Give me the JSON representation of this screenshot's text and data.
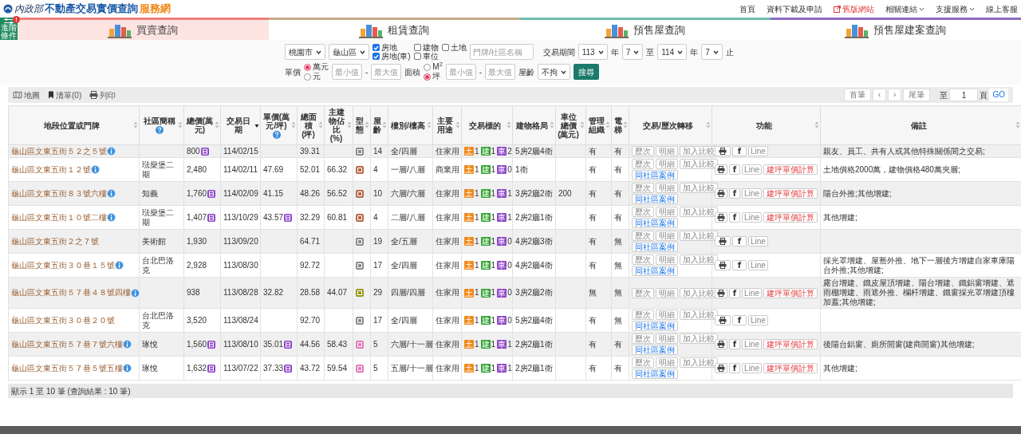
{
  "header": {
    "ministry": "內政部",
    "title": "不動產交易實價查詢",
    "suffix": "服務網",
    "nav": [
      {
        "label": "首頁",
        "kind": "link"
      },
      {
        "label": "資料下載及申請",
        "kind": "link"
      },
      {
        "label": "舊版網站",
        "kind": "external"
      },
      {
        "label": "相關連結",
        "kind": "dropdown"
      },
      {
        "label": "支援服務",
        "kind": "dropdown"
      },
      {
        "label": "線上客服",
        "kind": "link"
      }
    ]
  },
  "advanced_button": {
    "label": "進階條件",
    "badge": "!"
  },
  "tabs": [
    {
      "label": "買賣查詢",
      "selected": true,
      "color": "#ee7f7a"
    },
    {
      "label": "租賃查詢",
      "selected": false,
      "color": "#c9aa88"
    },
    {
      "label": "預售屋查詢",
      "selected": false,
      "color": "#6cc0ae"
    },
    {
      "label": "預售屋建案查詢",
      "selected": false,
      "color": "#8e6cc4"
    }
  ],
  "filters": {
    "city": "桃園市",
    "district": "龜山區",
    "types": [
      {
        "label": "房地",
        "checked": true
      },
      {
        "label": "建物",
        "checked": false
      },
      {
        "label": "土地",
        "checked": false
      },
      {
        "label": "房地(車)",
        "checked": true
      },
      {
        "label": "車位",
        "checked": false
      }
    ],
    "keyword_placeholder": "門牌/社區名稱",
    "period_label": "交易期間",
    "start_year": "113",
    "start_year_unit": "年",
    "start_month": "7",
    "to": "至",
    "end_year": "114",
    "end_year_unit": "年",
    "end_month": "7",
    "end": "止",
    "price_label": "單價",
    "price_units": [
      {
        "label": "萬元",
        "selected": true
      },
      {
        "label": "元",
        "selected": false
      }
    ],
    "price_min_placeholder": "最小值",
    "price_dash": "-",
    "price_max_placeholder": "最大值",
    "area_label": "面積",
    "area_units": [
      {
        "label": "M$^{2}$",
        "selected": false
      },
      {
        "label": "坪",
        "selected": true
      }
    ],
    "area_min_placeholder": "最小值",
    "area_dash": "-",
    "area_max_placeholder": "最大值",
    "age_label": "屋齡",
    "age_value": "不拘",
    "search_button": "搜尋"
  },
  "toolbar": {
    "map": "地圖",
    "list": "清單(0)",
    "print": "列印",
    "first": "首筆",
    "prev": "‹",
    "next": "›",
    "last": "尾筆",
    "goto_label": "至",
    "page": "1",
    "page_unit": "頁",
    "go": "GO"
  },
  "table": {
    "columns": [
      {
        "label": "地段位置或門牌",
        "help": false,
        "sorted": false
      },
      {
        "label": "社區簡稱",
        "help": true,
        "sorted": false
      },
      {
        "label": "總價(萬元)",
        "help": false,
        "sorted": false
      },
      {
        "label": "交易日期",
        "help": false,
        "sorted": true
      },
      {
        "label": "單價(萬元/坪)",
        "help": true,
        "sorted": false
      },
      {
        "label": "總面積(坪)",
        "help": false,
        "sorted": false
      },
      {
        "label": "主建物佔比(%)",
        "help": false,
        "sorted": false
      },
      {
        "label": "型態",
        "help": false,
        "sorted": false
      },
      {
        "label": "屋齡",
        "help": false,
        "sorted": false
      },
      {
        "label": "樓別/樓高",
        "help": false,
        "sorted": false
      },
      {
        "label": "主要用途",
        "help": false,
        "sorted": false
      },
      {
        "label": "交易標的",
        "help": false,
        "sorted": false
      },
      {
        "label": "建物格局",
        "help": false,
        "sorted": false
      },
      {
        "label": "車位總價(萬元)",
        "help": false,
        "sorted": false
      },
      {
        "label": "管理組織",
        "help": false,
        "sorted": false
      },
      {
        "label": "電梯",
        "help": false,
        "sorted": false
      },
      {
        "label": "交易/歷次轉移",
        "help": false,
        "sorted": false
      },
      {
        "label": "功能",
        "help": false,
        "sorted": false
      },
      {
        "label": "備註",
        "help": false,
        "sorted": false
      }
    ],
    "rows": [
      {
        "address": "龜山區文東五街５２之５號",
        "info": true,
        "price": "800",
        "price_badge": true,
        "date": "114/02/15",
        "unit_badge": false,
        "area": "39.31",
        "type": {
          "color": "#8c8c8c"
        },
        "age": "14",
        "floor": "全/四層",
        "use": "住家用",
        "target": [
          {
            "label": "土",
            "count": "1",
            "color": "#f08a1c"
          },
          {
            "label": "建",
            "count": "1",
            "color": "#2ea02e"
          },
          {
            "label": "車",
            "count": "2",
            "color": "#8e44c9"
          }
        ],
        "layout": "5房2廳4衛",
        "management": "有",
        "elevator": "有",
        "actions": [
          "歷次",
          "明細",
          "加入比較"
        ],
        "share": [
          "f",
          "Line"
        ],
        "remark": "親友、員工、共有人或其他特殊關係間之交易;"
      },
      {
        "address": "龜山區文東五街１２號",
        "info": true,
        "community": "琺燊堡二期",
        "price": "2,480",
        "price_badge": false,
        "date": "114/02/11",
        "unit_price": "47.69",
        "unit_badge": false,
        "area": "52.01",
        "ratio": "66.32",
        "type": {
          "color": "#b5694a"
        },
        "age": "4",
        "floor": "一層/八層",
        "use": "商業用",
        "target": [
          {
            "label": "土",
            "count": "1",
            "color": "#f08a1c"
          },
          {
            "label": "建",
            "count": "1",
            "color": "#2ea02e"
          },
          {
            "label": "車",
            "count": "0",
            "color": "#8e44c9"
          }
        ],
        "layout": "1衛",
        "management": "有",
        "elevator": "有",
        "actions": [
          "歷次",
          "明細",
          "加入比較",
          "同社區案例"
        ],
        "share": [
          "f",
          "Line",
          "建坪單價計算"
        ],
        "remark": "土地價格2000萬，建物價格480萬夾層;"
      },
      {
        "address": "龜山區文東五街８３號六樓",
        "info": true,
        "community": "知義",
        "price": "1,760",
        "price_badge": true,
        "date": "114/02/09",
        "unit_price": "41.15",
        "unit_badge": false,
        "area": "48.26",
        "ratio": "56.52",
        "type": {
          "color": "#b5694a"
        },
        "age": "10",
        "floor": "六層/六層",
        "use": "住家用",
        "target": [
          {
            "label": "土",
            "count": "1",
            "color": "#f08a1c"
          },
          {
            "label": "建",
            "count": "1",
            "color": "#2ea02e"
          },
          {
            "label": "車",
            "count": "1",
            "color": "#8e44c9"
          }
        ],
        "layout": "3房2廳2衛",
        "parking": "200",
        "management": "有",
        "elevator": "有",
        "actions": [
          "歷次",
          "明細",
          "加入比較",
          "同社區案例"
        ],
        "share": [
          "f",
          "Line",
          "建坪單價計算"
        ],
        "remark": "陽台外推;其他增建;"
      },
      {
        "address": "龜山區文東五街１０號二樓",
        "info": true,
        "community": "琺燊堡二期",
        "price": "1,407",
        "price_badge": true,
        "date": "113/10/29",
        "unit_price": "43.57",
        "unit_badge": true,
        "area": "32.29",
        "ratio": "60.81",
        "type": {
          "color": "#b5694a"
        },
        "age": "4",
        "floor": "二層/八層",
        "use": "住家用",
        "target": [
          {
            "label": "土",
            "count": "1",
            "color": "#f08a1c"
          },
          {
            "label": "建",
            "count": "1",
            "color": "#2ea02e"
          },
          {
            "label": "車",
            "count": "1",
            "color": "#8e44c9"
          }
        ],
        "layout": "2房2廳1衛",
        "management": "有",
        "elevator": "有",
        "actions": [
          "歷次",
          "明細",
          "加入比較",
          "同社區案例"
        ],
        "share": [
          "f",
          "Line",
          "建坪單價計算"
        ],
        "remark": "其他增建;"
      },
      {
        "address": "龜山區文東五街２之７號",
        "info": false,
        "community": "美術館",
        "price": "1,930",
        "price_badge": false,
        "date": "113/09/20",
        "unit_badge": false,
        "area": "64.71",
        "type": {
          "color": "#8c8c8c"
        },
        "age": "19",
        "floor": "全/五層",
        "use": "住家用",
        "target": [
          {
            "label": "土",
            "count": "1",
            "color": "#f08a1c"
          },
          {
            "label": "建",
            "count": "1",
            "color": "#2ea02e"
          },
          {
            "label": "車",
            "count": "0",
            "color": "#8e44c9"
          }
        ],
        "layout": "4房2廳3衛",
        "management": "有",
        "elevator": "無",
        "actions": [
          "歷次",
          "明細",
          "加入比較",
          "同社區案例"
        ],
        "share": [
          "f",
          "Line"
        ]
      },
      {
        "address": "龜山區文東五街３０巷１５號",
        "info": true,
        "community": "台北巴洛克",
        "price": "2,928",
        "price_badge": false,
        "date": "113/08/30",
        "unit_badge": false,
        "area": "92.72",
        "type": {
          "color": "#8c8c8c"
        },
        "age": "17",
        "floor": "全/四層",
        "use": "住家用",
        "target": [
          {
            "label": "土",
            "count": "1",
            "color": "#f08a1c"
          },
          {
            "label": "建",
            "count": "1",
            "color": "#2ea02e"
          },
          {
            "label": "車",
            "count": "0",
            "color": "#8e44c9"
          }
        ],
        "layout": "4房2廳4衛",
        "management": "有",
        "elevator": "無",
        "actions": [
          "歷次",
          "明細",
          "加入比較",
          "同社區案例"
        ],
        "share": [
          "f",
          "Line"
        ],
        "remark": "採光罩增建、屋簷外推、地下一層後方增建自家車庫陽台外推;其他增建;"
      },
      {
        "address": "龜山區文東五街５７巷４８號四樓",
        "info": true,
        "price": "938",
        "price_badge": false,
        "date": "113/08/28",
        "unit_price": "32.82",
        "unit_badge": false,
        "area": "28.58",
        "ratio": "44.07",
        "type": {
          "color": "#9a9a1e"
        },
        "age": "29",
        "floor": "四層/四層",
        "use": "住家用",
        "target": [
          {
            "label": "土",
            "count": "1",
            "color": "#f08a1c"
          },
          {
            "label": "建",
            "count": "1",
            "color": "#2ea02e"
          },
          {
            "label": "車",
            "count": "0",
            "color": "#8e44c9"
          }
        ],
        "layout": "3房2廳2衛",
        "management": "無",
        "elevator": "無",
        "actions": [
          "歷次",
          "明細",
          "加入比較"
        ],
        "share": [
          "f",
          "Line",
          "建坪單價計算"
        ],
        "remark": "露台增建、鐵皮屋頂增建、陽台增建、鐵鋁窗增建、遮雨棚增建、雨遮外推、欄杆增建、鐵窗採光罩增建頂樓加蓋;其他增建;"
      },
      {
        "address": "龜山區文東五街３０巷２０號",
        "info": false,
        "community": "台北巴洛克",
        "price": "3,520",
        "price_badge": false,
        "date": "113/08/24",
        "unit_badge": false,
        "area": "92.70",
        "type": {
          "color": "#8c8c8c"
        },
        "age": "17",
        "floor": "全/四層",
        "use": "住家用",
        "target": [
          {
            "label": "土",
            "count": "1",
            "color": "#f08a1c"
          },
          {
            "label": "建",
            "count": "1",
            "color": "#2ea02e"
          },
          {
            "label": "車",
            "count": "0",
            "color": "#8e44c9"
          }
        ],
        "layout": "5房2廳4衛",
        "management": "有",
        "elevator": "無",
        "actions": [
          "歷次",
          "明細",
          "加入比較",
          "同社區案例"
        ],
        "share": [
          "f",
          "Line"
        ]
      },
      {
        "address": "龜山區文東五街５７巷７號六樓",
        "info": true,
        "community": "琢悅",
        "price": "1,560",
        "price_badge": true,
        "date": "113/08/10",
        "unit_price": "35.01",
        "unit_badge": true,
        "area": "44.56",
        "ratio": "58.43",
        "type": {
          "color": "#e27bb5"
        },
        "age": "5",
        "floor": "六層/十一層",
        "use": "住家用",
        "target": [
          {
            "label": "土",
            "count": "1",
            "color": "#f08a1c"
          },
          {
            "label": "建",
            "count": "1",
            "color": "#2ea02e"
          },
          {
            "label": "車",
            "count": "1",
            "color": "#8e44c9"
          }
        ],
        "layout": "2房2廳1衛",
        "management": "有",
        "elevator": "有",
        "actions": [
          "歷次",
          "明細",
          "加入比較",
          "同社區案例"
        ],
        "share": [
          "f",
          "Line",
          "建坪單價計算"
        ],
        "remark": "後陽台鋁窗、廁所開窗(建商開窗)其他增建;"
      },
      {
        "address": "龜山區文東五街５７巷５號五樓",
        "info": true,
        "community": "琢悅",
        "price": "1,632",
        "price_badge": true,
        "date": "113/07/22",
        "unit_price": "37.33",
        "unit_badge": true,
        "area": "43.72",
        "ratio": "59.54",
        "type": {
          "color": "#e27bb5"
        },
        "age": "5",
        "floor": "五層/十一層",
        "use": "住家用",
        "target": [
          {
            "label": "土",
            "count": "1",
            "color": "#f08a1c"
          },
          {
            "label": "建",
            "count": "1",
            "color": "#2ea02e"
          },
          {
            "label": "車",
            "count": "1",
            "color": "#8e44c9"
          }
        ],
        "layout": "2房2廳1衛",
        "management": "有",
        "elevator": "有",
        "actions": [
          "歷次",
          "明細",
          "加入比較",
          "同社區案例"
        ],
        "share": [
          "f",
          "Line",
          "建坪單價計算"
        ],
        "remark": "其他增建;"
      }
    ]
  },
  "footer": "顯示 1 至 10 筆 (查詢結果 : 10 筆)"
}
